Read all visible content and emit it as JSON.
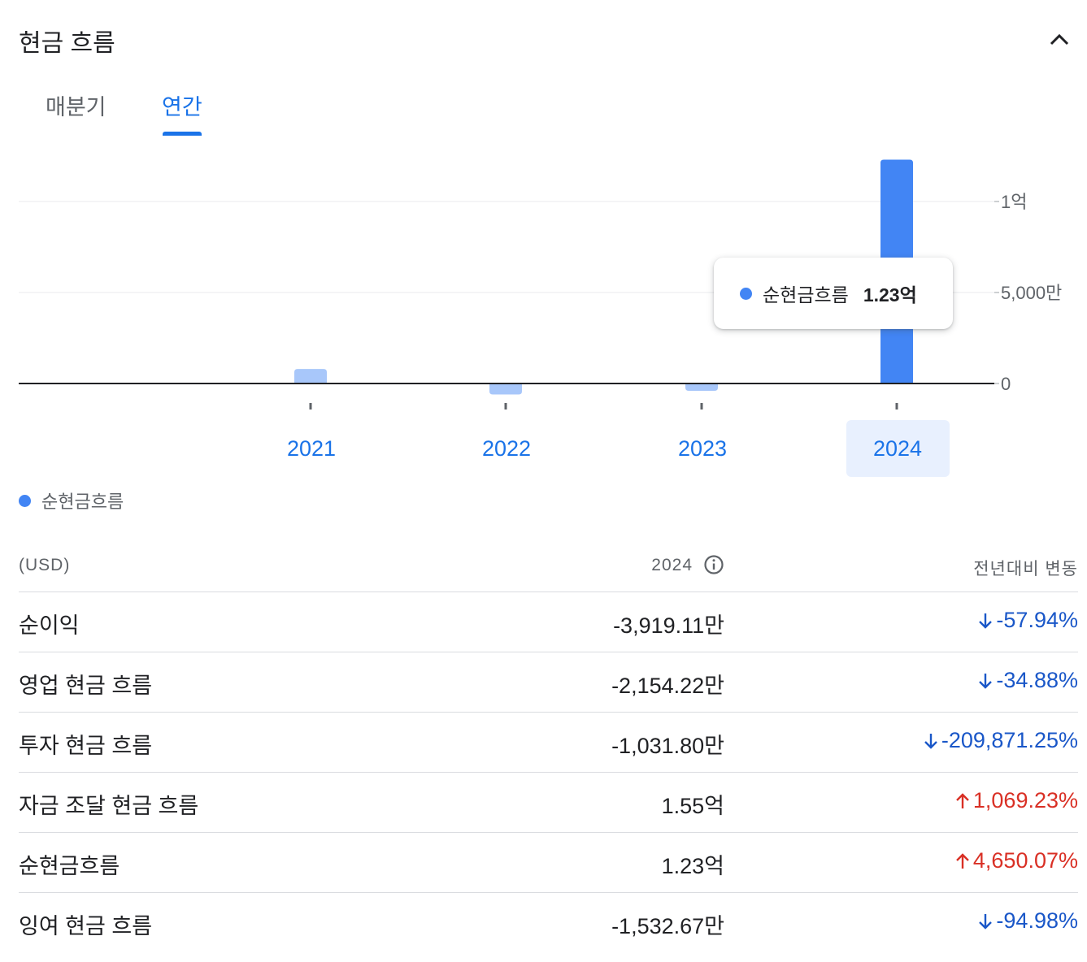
{
  "section": {
    "title": "현금 흐름"
  },
  "tabs": [
    {
      "label": "매분기",
      "active": false
    },
    {
      "label": "연간",
      "active": true
    }
  ],
  "chart_data": {
    "type": "bar",
    "categories": [
      "2021",
      "2022",
      "2023",
      "2024"
    ],
    "series": [
      {
        "name": "순현금흐름",
        "values": [
          8000000,
          -6000000,
          -4000000,
          123000000
        ],
        "color": "#4285f4"
      }
    ],
    "ylim": [
      -8000000,
      124000000
    ],
    "yticks": [
      {
        "value": 0,
        "label": "0"
      },
      {
        "value": 50000000,
        "label": "5,000만"
      },
      {
        "value": 100000000,
        "label": "1억"
      }
    ],
    "grid": true,
    "selected_category": "2024",
    "tooltip": {
      "series": "순현금흐름",
      "value": "1.23억"
    },
    "legend": "bottom-left"
  },
  "colors": {
    "accent": "#1a73e8",
    "bar_selected": "#4285f4",
    "bar_unselected": "#a8c7fa",
    "negative": "#1a57c8",
    "positive": "#d93025"
  },
  "table": {
    "unit_header": "(USD)",
    "year_header": "2024",
    "change_header": "전년대비 변동",
    "rows": [
      {
        "label": "순이익",
        "value": "-3,919.11만",
        "change": "-57.94%",
        "direction": "down"
      },
      {
        "label": "영업 현금 흐름",
        "value": "-2,154.22만",
        "change": "-34.88%",
        "direction": "down"
      },
      {
        "label": "투자 현금 흐름",
        "value": "-1,031.80만",
        "change": "-209,871.25%",
        "direction": "down"
      },
      {
        "label": "자금 조달 현금 흐름",
        "value": "1.55억",
        "change": "1,069.23%",
        "direction": "up"
      },
      {
        "label": "순현금흐름",
        "value": "1.23억",
        "change": "4,650.07%",
        "direction": "up"
      },
      {
        "label": "잉여 현금 흐름",
        "value": "-1,532.67만",
        "change": "-94.98%",
        "direction": "down"
      }
    ]
  }
}
